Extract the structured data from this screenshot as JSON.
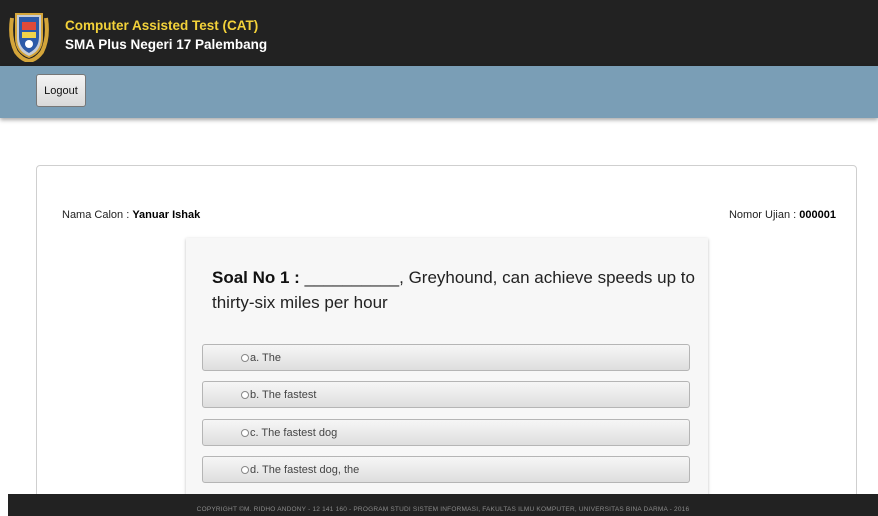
{
  "header": {
    "title": "Computer Assisted Test (CAT)",
    "subtitle": "SMA Plus Negeri 17 Palembang",
    "logo_icon": "school-crest-icon"
  },
  "navbar": {
    "logout_label": "Logout"
  },
  "candidate": {
    "name_label": "Nama Calon :",
    "name_value": "Yanuar Ishak",
    "number_label": "Nomor Ujian :",
    "number_value": "000001"
  },
  "question": {
    "number_label": "Soal No 1 :",
    "text": " __________, Greyhound, can achieve speeds up to thirty-six miles per hour"
  },
  "options": [
    {
      "label": "a. The"
    },
    {
      "label": "b. The fastest"
    },
    {
      "label": "c. The fastest dog"
    },
    {
      "label": "d. The fastest dog, the"
    }
  ],
  "footer": {
    "text": "COPYRIGHT ©M. RIDHO ANDONY - 12 141 160 - PROGRAM STUDI SISTEM INFORMASI, FAKULTAS ILMU KOMPUTER, UNIVERSITAS BINA DARMA - 2016"
  },
  "colors": {
    "header_bg": "#222222",
    "title": "#f3d23a",
    "navbar": "#7a9eb6"
  }
}
